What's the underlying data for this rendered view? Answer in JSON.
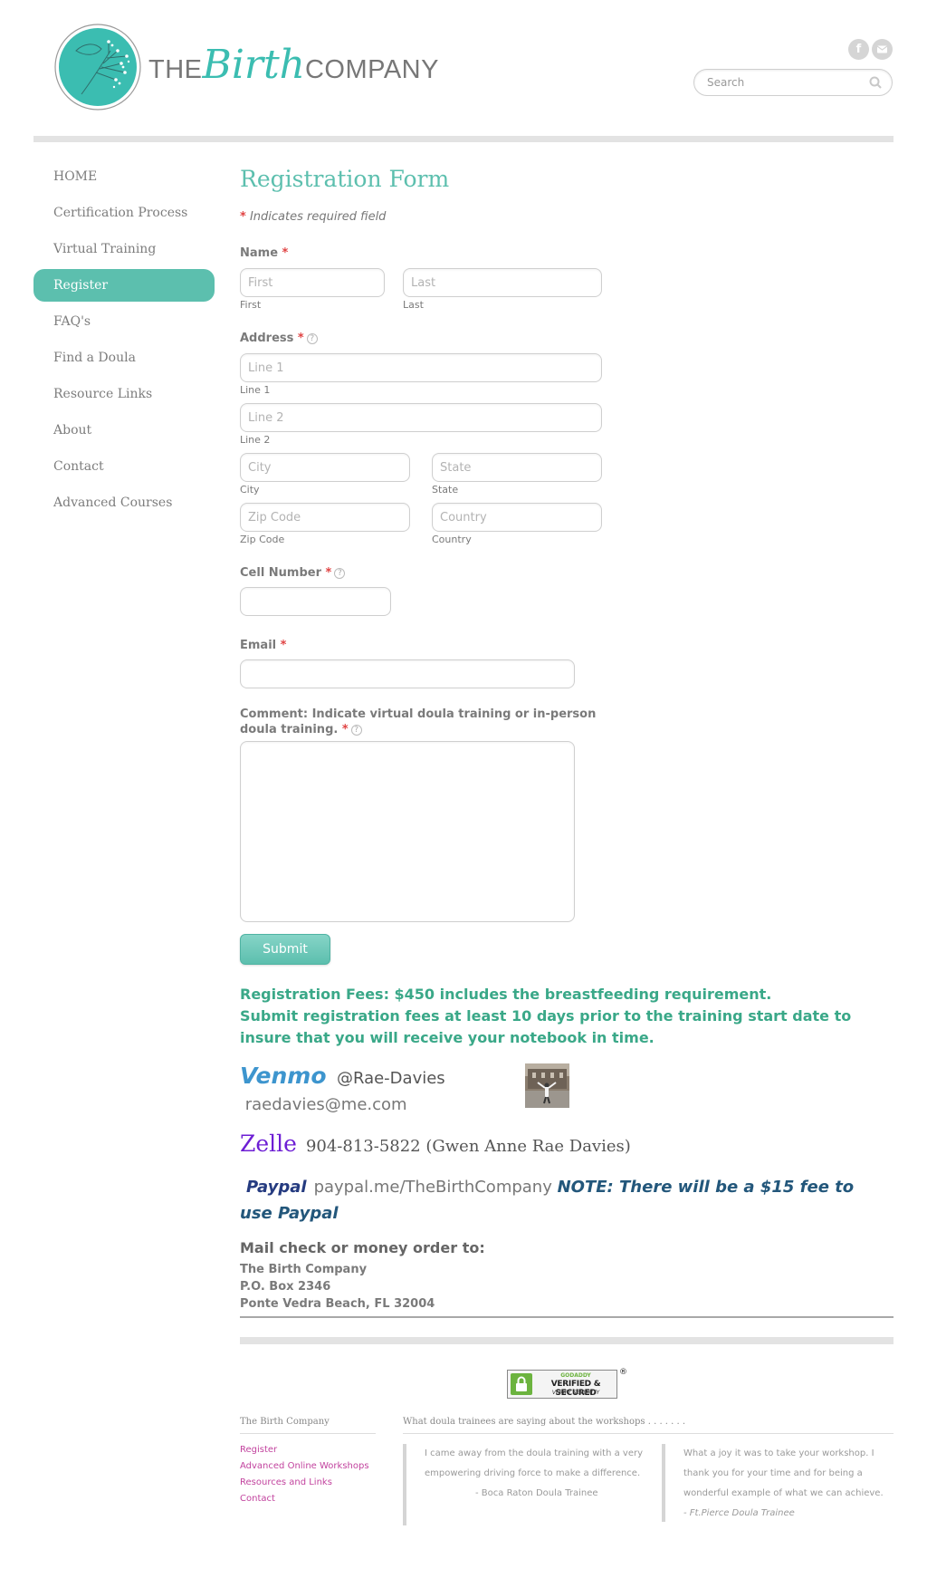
{
  "header": {
    "brand_the": "THE",
    "brand_birth": "Birth",
    "brand_company": "COMPANY",
    "search_placeholder": "Search",
    "social": [
      "facebook-icon",
      "email-icon"
    ]
  },
  "nav": {
    "items": [
      {
        "label": "HOME",
        "active": false
      },
      {
        "label": "Certification Process",
        "active": false
      },
      {
        "label": "Virtual Training",
        "active": false
      },
      {
        "label": "Register",
        "active": true
      },
      {
        "label": "FAQ's",
        "active": false
      },
      {
        "label": "Find a Doula",
        "active": false
      },
      {
        "label": "Resource Links",
        "active": false
      },
      {
        "label": "About",
        "active": false
      },
      {
        "label": "Contact",
        "active": false
      },
      {
        "label": "Advanced Courses",
        "active": false
      }
    ]
  },
  "form": {
    "title": "Registration Form",
    "required_note": "Indicates required field",
    "star": "*",
    "help_glyph": "?",
    "name_label": "Name",
    "first_placeholder": "First",
    "first_sub": "First",
    "last_placeholder": "Last",
    "last_sub": "Last",
    "address_label": "Address",
    "line1_placeholder": "Line 1",
    "line1_sub": "Line 1",
    "line2_placeholder": "Line 2",
    "line2_sub": "Line 2",
    "city_placeholder": "City",
    "city_sub": "City",
    "state_placeholder": "State",
    "state_sub": "State",
    "zip_placeholder": "Zip Code",
    "zip_sub": "Zip Code",
    "country_placeholder": "Country",
    "country_sub": "Country",
    "cell_label": "Cell Number",
    "cell_value": "",
    "email_label": "Email",
    "email_value": "",
    "comment_label": "Comment: Indicate virtual doula training or in-person doula training.",
    "comment_value": "",
    "submit_label": "Submit"
  },
  "fees": {
    "line1": "Registration Fees: $450 includes the breastfeeding requirement.",
    "line2": "Submit registration fees at least 10 days prior to the training start date to insure that you will receive your notebook in time."
  },
  "payments": {
    "venmo_label": "Venmo",
    "venmo_handle": "@Rae-Davies",
    "venmo_email": "raedavies@me.com",
    "zelle_label": "Zelle",
    "zelle_detail": "904-813-5822 (Gwen Anne Rae Davies)",
    "paypal_label": "Paypal",
    "paypal_link": "paypal.me/TheBirthCompany",
    "paypal_note": "NOTE: There will be a $15 fee to use Paypal"
  },
  "mail": {
    "heading": "Mail check or money order to:",
    "lines": [
      "The Birth Company",
      "P.O. Box 2346",
      "Ponte Vedra Beach, FL 32004"
    ]
  },
  "footer": {
    "seal": {
      "godaddy": "GODADDY",
      "verified": "VERIFIED & SECURED",
      "verify": "VERIFY SECURITY",
      "reg": "®"
    },
    "company_heading": "The Birth Company",
    "links": [
      "Register",
      "Advanced Online Workshops",
      "Resources and Links",
      "Contact"
    ],
    "testimonials_heading": "What doula trainees are saying about the workshops . . . . . . .",
    "quotes": [
      {
        "text": "I came away from the doula training with a very empowering driving force to make a difference.",
        "author": "- Boca Raton Doula Trainee"
      },
      {
        "text": "What a joy it was to take your workshop.  I thank you for your time and for being a wonderful example of what we can achieve.",
        "author": " - Ft.Pierce Doula Trainee"
      }
    ]
  },
  "colors": {
    "accent": "#5cbfae",
    "fees_green": "#3aa888",
    "required_red": "#e04343",
    "venmo_blue": "#3d95ce",
    "zelle_purple": "#6d1ed4",
    "paypal_navy": "#253b80",
    "footer_link": "#c2439e"
  }
}
